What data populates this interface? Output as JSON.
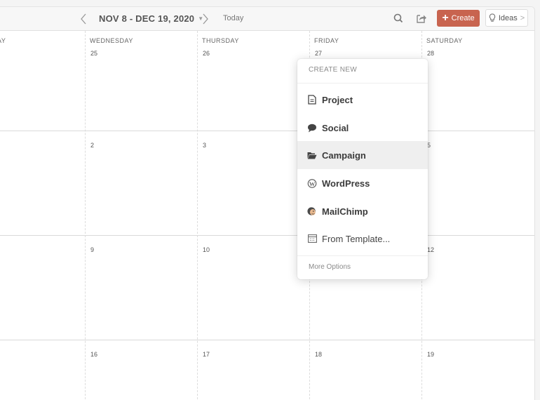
{
  "toolbar": {
    "date_range": "NOV 8 - DEC 19, 2020",
    "today_label": "Today",
    "create_label": "Create",
    "ideas_label": "Ideas",
    "create_color": "#c8644f"
  },
  "calendar": {
    "day_names": [
      "AY",
      "WEDNESDAY",
      "THURSDAY",
      "FRIDAY",
      "SATURDAY"
    ],
    "weeks": [
      [
        "",
        "25",
        "26",
        "27",
        "28"
      ],
      [
        "",
        "2",
        "3",
        "",
        "5"
      ],
      [
        "",
        "9",
        "10",
        "",
        "12"
      ],
      [
        "",
        "16",
        "17",
        "18",
        "19"
      ]
    ]
  },
  "create_menu": {
    "header": "CREATE NEW",
    "items": [
      {
        "label": "Project",
        "icon": "document-icon"
      },
      {
        "label": "Social",
        "icon": "speech-bubble-icon"
      },
      {
        "label": "Campaign",
        "icon": "folder-open-icon",
        "active": true
      },
      {
        "label": "WordPress",
        "icon": "wordpress-icon"
      },
      {
        "label": "MailChimp",
        "icon": "mailchimp-icon"
      },
      {
        "label": "From Template...",
        "icon": "template-icon"
      }
    ],
    "more_label": "More Options"
  }
}
